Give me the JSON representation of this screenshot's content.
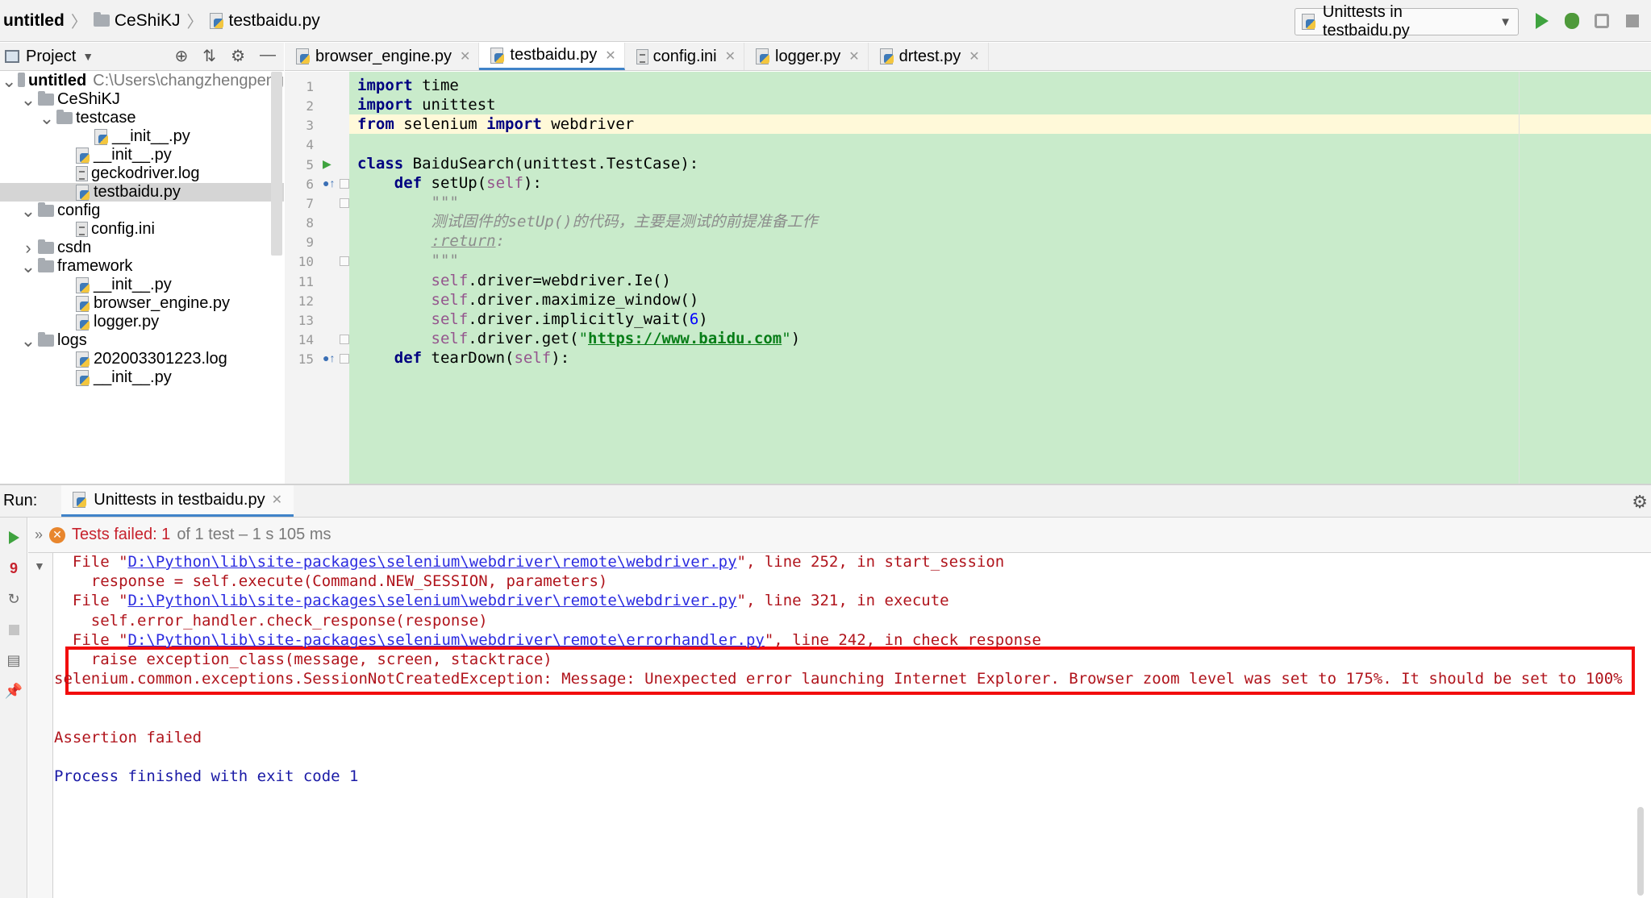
{
  "breadcrumb": {
    "project": "untitled",
    "folder": "CeShiKJ",
    "file": "testbaidu.py"
  },
  "toolbar": {
    "run_config": "Unittests in testbaidu.py",
    "icons": [
      "run-icon",
      "debug-icon",
      "coverage-icon",
      "stop-icon"
    ]
  },
  "project_panel": {
    "title": "Project",
    "tree": [
      {
        "label": "untitled",
        "path": "C:\\Users\\changzhengpeng",
        "indent": 0,
        "type": "folder",
        "expanded": true,
        "bold": true
      },
      {
        "label": "CeShiKJ",
        "indent": 1,
        "type": "folder",
        "expanded": true
      },
      {
        "label": "testcase",
        "indent": 2,
        "type": "folder",
        "expanded": true
      },
      {
        "label": "__init__.py",
        "indent": 3,
        "type": "py"
      },
      {
        "label": "__init__.py",
        "indent": 2,
        "type": "py"
      },
      {
        "label": "geckodriver.log",
        "indent": 2,
        "type": "file"
      },
      {
        "label": "testbaidu.py",
        "indent": 2,
        "type": "py",
        "selected": true
      },
      {
        "label": "config",
        "indent": 1,
        "type": "folder",
        "expanded": true
      },
      {
        "label": "config.ini",
        "indent": 2,
        "type": "file"
      },
      {
        "label": "csdn",
        "indent": 1,
        "type": "folder",
        "expanded": false
      },
      {
        "label": "framework",
        "indent": 1,
        "type": "folder",
        "expanded": true
      },
      {
        "label": "__init__.py",
        "indent": 2,
        "type": "py"
      },
      {
        "label": "browser_engine.py",
        "indent": 2,
        "type": "py"
      },
      {
        "label": "logger.py",
        "indent": 2,
        "type": "py"
      },
      {
        "label": "logs",
        "indent": 1,
        "type": "folder",
        "expanded": true
      },
      {
        "label": "202003301223.log",
        "indent": 2,
        "type": "py"
      },
      {
        "label": "__init__.py",
        "indent": 2,
        "type": "py"
      }
    ]
  },
  "editor": {
    "tabs": [
      {
        "label": "browser_engine.py",
        "type": "py",
        "active": false
      },
      {
        "label": "testbaidu.py",
        "type": "py",
        "active": true
      },
      {
        "label": "config.ini",
        "type": "file",
        "active": false
      },
      {
        "label": "logger.py",
        "type": "py",
        "active": false
      },
      {
        "label": "drtest.py",
        "type": "py",
        "active": false
      }
    ],
    "lines": [
      {
        "n": "1",
        "tokens": [
          [
            "kw",
            "import"
          ],
          [
            "",
            " time"
          ]
        ]
      },
      {
        "n": "2",
        "tokens": [
          [
            "kw",
            "import"
          ],
          [
            "",
            " unittest"
          ]
        ]
      },
      {
        "n": "3",
        "tokens": [
          [
            "kw",
            "from"
          ],
          [
            "",
            " selenium "
          ],
          [
            "kw",
            "import"
          ],
          [
            "",
            " webdriver"
          ]
        ]
      },
      {
        "n": "4",
        "tokens": []
      },
      {
        "n": "5",
        "tokens": [
          [
            "kw",
            "class"
          ],
          [
            "",
            " BaiduSearch(unittest.TestCase):"
          ]
        ]
      },
      {
        "n": "6",
        "tokens": [
          [
            "",
            "    "
          ],
          [
            "kw",
            "def"
          ],
          [
            "",
            " setUp("
          ],
          [
            "self",
            "self"
          ],
          [
            "",
            "):"
          ]
        ]
      },
      {
        "n": "7",
        "tokens": [
          [
            "",
            "        "
          ],
          [
            "doc",
            "\"\"\""
          ]
        ]
      },
      {
        "n": "8",
        "tokens": [
          [
            "",
            "        "
          ],
          [
            "doc",
            "测试固件的setUp()的代码，主要是测试的前提准备工作"
          ]
        ]
      },
      {
        "n": "9",
        "tokens": [
          [
            "",
            "        "
          ],
          [
            "docu",
            ":return"
          ],
          [
            "doc",
            ":"
          ]
        ]
      },
      {
        "n": "10",
        "tokens": [
          [
            "",
            "        "
          ],
          [
            "doc",
            "\"\"\""
          ]
        ]
      },
      {
        "n": "11",
        "tokens": [
          [
            "",
            "        "
          ],
          [
            "self",
            "self"
          ],
          [
            "",
            ".driver=webdriver.Ie()"
          ]
        ]
      },
      {
        "n": "12",
        "tokens": [
          [
            "",
            "        "
          ],
          [
            "self",
            "self"
          ],
          [
            "",
            ".driver.maximize_window()"
          ]
        ]
      },
      {
        "n": "13",
        "tokens": [
          [
            "",
            "        "
          ],
          [
            "self",
            "self"
          ],
          [
            "",
            ".driver.implicitly_wait("
          ],
          [
            "num",
            "6"
          ],
          [
            "",
            ")"
          ]
        ]
      },
      {
        "n": "14",
        "tokens": [
          [
            "",
            "        "
          ],
          [
            "self",
            "self"
          ],
          [
            "",
            ".driver.get("
          ],
          [
            "str",
            "\""
          ],
          [
            "url",
            "https://www.baidu.com"
          ],
          [
            "str",
            "\""
          ],
          [
            "",
            ")"
          ]
        ]
      },
      {
        "n": "15",
        "tokens": [
          [
            "",
            "    "
          ],
          [
            "kw",
            "def"
          ],
          [
            "",
            " tearDown("
          ],
          [
            "self",
            "self"
          ],
          [
            "",
            "):"
          ]
        ]
      }
    ]
  },
  "run_panel": {
    "label": "Run:",
    "tab": "Unittests in testbaidu.py",
    "status_bold": "Tests failed: 1",
    "status_rest": "of 1 test – 1 s 105 ms",
    "failed_badge": "9",
    "console": [
      {
        "indent": "  ",
        "pre": "File \"",
        "link": "D:\\Python\\lib\\site-packages\\selenium\\webdriver\\remote\\webdriver.py",
        "post": "\", line 252, in start_session",
        "color": "red"
      },
      {
        "indent": "    ",
        "pre": "response = self.execute(Command.NEW_SESSION, parameters)",
        "color": "red"
      },
      {
        "indent": "  ",
        "pre": "File \"",
        "link": "D:\\Python\\lib\\site-packages\\selenium\\webdriver\\remote\\webdriver.py",
        "post": "\", line 321, in execute",
        "color": "red"
      },
      {
        "indent": "    ",
        "pre": "self.error_handler.check_response(response)",
        "color": "red"
      },
      {
        "indent": "  ",
        "pre": "File \"",
        "link": "D:\\Python\\lib\\site-packages\\selenium\\webdriver\\remote\\errorhandler.py",
        "post": "\", line 242, in check_response",
        "color": "red"
      },
      {
        "indent": "    ",
        "pre": "raise exception_class(message, screen, stacktrace)",
        "color": "red"
      },
      {
        "indent": "",
        "pre": "selenium.common.exceptions.SessionNotCreatedException: Message: Unexpected error launching Internet Explorer. Browser zoom level was set to 175%. It should be set to 100%",
        "color": "red"
      },
      {
        "indent": "",
        "pre": "",
        "color": "red"
      },
      {
        "indent": "",
        "pre": "",
        "color": "red"
      },
      {
        "indent": "",
        "pre": "Assertion failed",
        "color": "red"
      },
      {
        "indent": "",
        "pre": "",
        "color": "red"
      },
      {
        "indent": "",
        "pre": "Process finished with exit code 1",
        "color": "blue"
      }
    ]
  },
  "colors": {
    "code_bg": "#c9ebcb",
    "caret_line": "#fff9d9",
    "error_text": "#b0141c",
    "highlight_box": "#f20d0d",
    "accent": "#4083c9"
  }
}
